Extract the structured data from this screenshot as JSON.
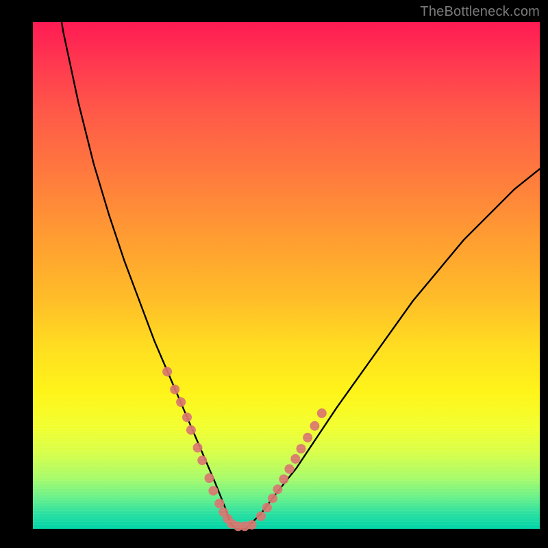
{
  "watermark": "TheBottleneck.com",
  "colors": {
    "curve_stroke": "#000000",
    "dot_fill": "#d9756f",
    "background_black": "#000000"
  },
  "chart_data": {
    "type": "line",
    "title": "",
    "xlabel": "",
    "ylabel": "",
    "xlim": [
      0,
      100
    ],
    "ylim": [
      0,
      100
    ],
    "grid": false,
    "legend": false,
    "note": "Axes unlabeled. Values are estimated from pixel positions inside the 740×740 plot area. y=100 is top (red), y=0 is bottom (green). Curve reaches minimum (~0) near x≈39–43.",
    "series": [
      {
        "name": "bottleneck-curve",
        "x": [
          0,
          3,
          6,
          9,
          12,
          15,
          18,
          21,
          24,
          27,
          30,
          33,
          36,
          38,
          39,
          40,
          41,
          42,
          43,
          45,
          48,
          52,
          56,
          60,
          65,
          70,
          75,
          80,
          85,
          90,
          95,
          100
        ],
        "y": [
          140,
          116,
          98,
          84,
          72,
          62,
          53,
          45,
          37,
          30,
          23,
          16,
          9,
          4,
          1,
          0,
          0,
          0,
          1,
          3,
          7,
          12,
          18,
          24,
          31,
          38,
          45,
          51,
          57,
          62,
          67,
          71
        ]
      }
    ],
    "points": {
      "name": "highlighted-dots",
      "note": "Salmon dots clustered along both branches near the valley.",
      "x": [
        26.5,
        28.0,
        29.2,
        30.4,
        31.2,
        32.5,
        33.4,
        34.8,
        35.6,
        36.8,
        37.6,
        38.4,
        39.2,
        40.5,
        41.8,
        43.2,
        45.0,
        46.2,
        47.3,
        48.3,
        49.5,
        50.6,
        51.8,
        52.9,
        54.2,
        55.6,
        57.0
      ],
      "y": [
        31.0,
        27.5,
        25.0,
        22.0,
        19.5,
        16.0,
        13.5,
        10.0,
        7.5,
        5.0,
        3.3,
        2.0,
        1.0,
        0.5,
        0.5,
        0.8,
        2.5,
        4.2,
        6.0,
        7.8,
        9.8,
        11.8,
        13.8,
        15.8,
        18.0,
        20.3,
        22.8
      ]
    }
  }
}
